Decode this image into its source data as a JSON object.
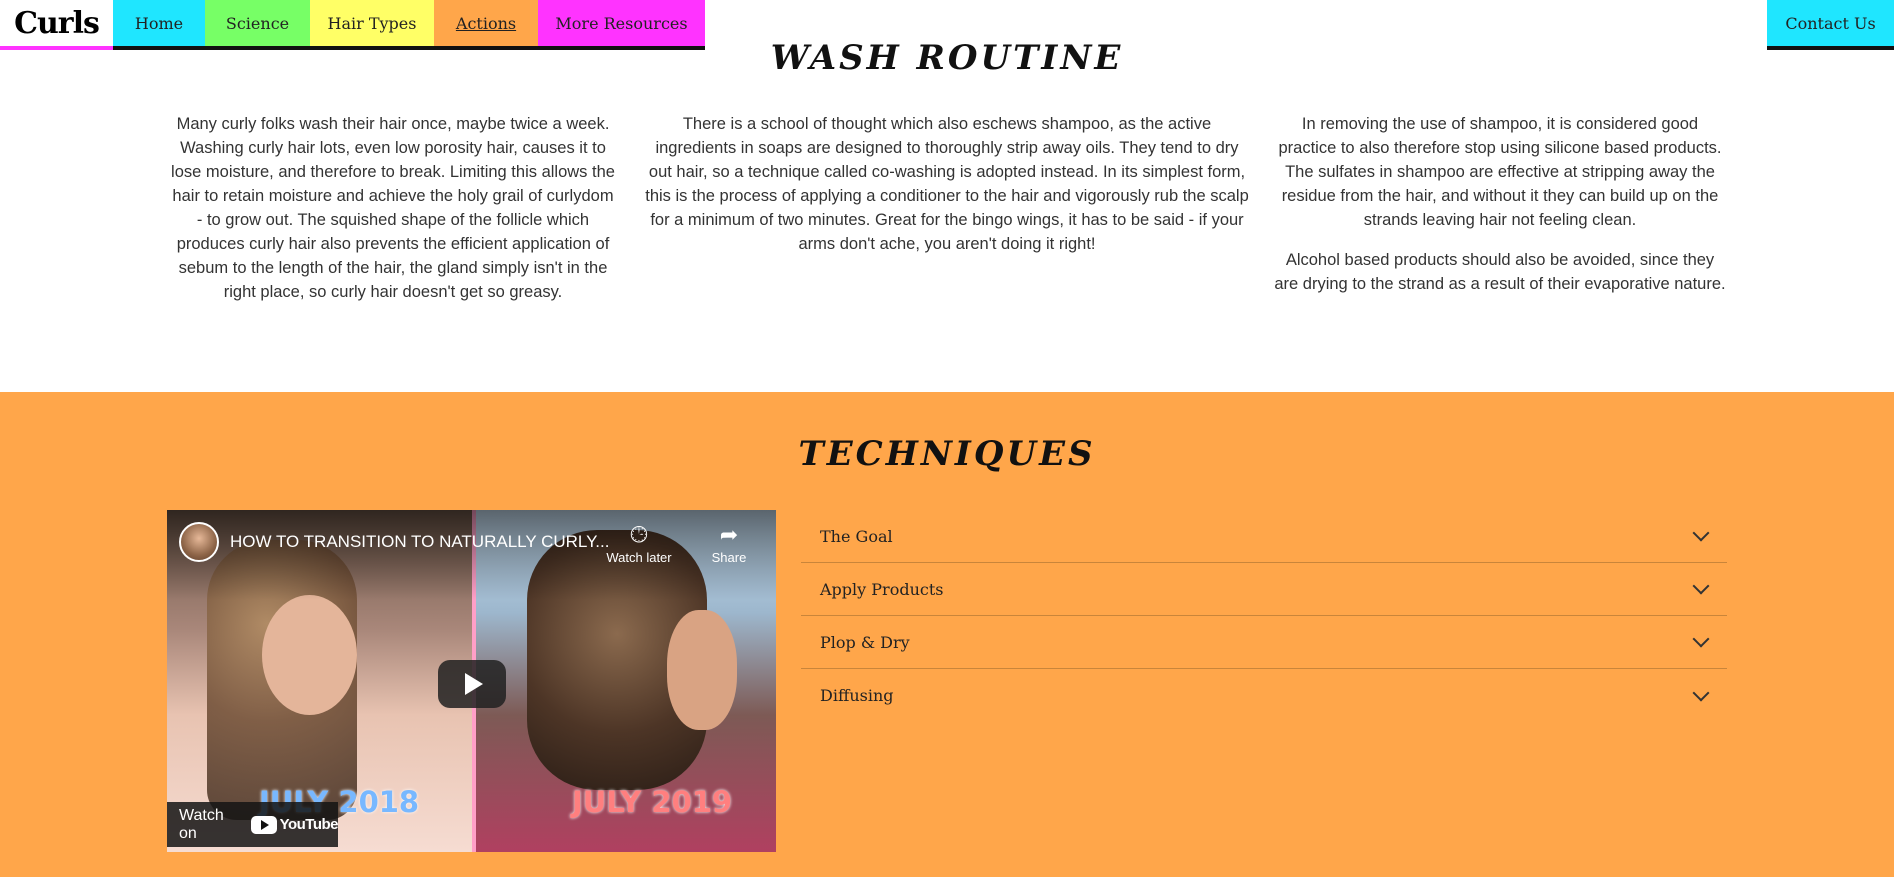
{
  "nav": {
    "brand": "Curls",
    "items": [
      {
        "label": "Home",
        "color": "#1fe6ff",
        "width": 92
      },
      {
        "label": "Science",
        "color": "#77ff66",
        "width": 105
      },
      {
        "label": "Hair Types",
        "color": "#ffff66",
        "width": 124
      },
      {
        "label": "Actions",
        "color": "#ffa64a",
        "width": 104,
        "active": true
      },
      {
        "label": "More Resources",
        "color": "#ff33ff",
        "width": 167
      }
    ],
    "contact": "Contact Us",
    "contact_color": "#1fe6ff"
  },
  "wash": {
    "title": "WASH ROUTINE",
    "col1": "Many curly folks wash their hair once, maybe twice a week. Washing curly hair lots, even low porosity hair, causes it to lose moisture, and therefore to break. Limiting this allows the hair to retain moisture and achieve the holy grail of curlydom - to grow out. The squished shape of the follicle which produces curly hair also prevents the efficient application of sebum to the length of the hair, the gland simply isn't in the right place, so curly hair doesn't get so greasy.",
    "col2": "There is a school of thought which also eschews shampoo, as the active ingredients in soaps are designed to thoroughly strip away oils. They tend to dry out hair, so a technique called co-washing is adopted instead. In its simplest form, this is the process of applying a conditioner to the hair and vigorously rub the scalp for a minimum of two minutes. Great for the bingo wings, it has to be said - if your arms don't ache, you aren't doing it right!",
    "col3_p1": "In removing the use of shampoo, it is considered good practice to also therefore stop using silicone based products. The sulfates in shampoo are effective at stripping away the residue from the hair, and without it they can build up on the strands leaving hair not feeling clean.",
    "col3_p2": "Alcohol based products should also be avoided, since they are drying to the strand as a result of their evaporative nature."
  },
  "techniques": {
    "title": "TECHNIQUES",
    "background": "#ffa64a",
    "video": {
      "title": "HOW TO TRANSITION TO NATURALLY CURLY...",
      "watch_later": "Watch later",
      "share": "Share",
      "year_left": "JULY 2018",
      "year_right": "JULY 2019",
      "watch_on": "Watch on",
      "youtube": "YouTube",
      "watch_later_icon": "clock-icon",
      "share_icon": "share-arrow-icon",
      "play_icon": "play-icon"
    },
    "accordion": [
      {
        "label": "The Goal"
      },
      {
        "label": "Apply Products"
      },
      {
        "label": "Plop & Dry"
      },
      {
        "label": "Diffusing"
      }
    ]
  }
}
